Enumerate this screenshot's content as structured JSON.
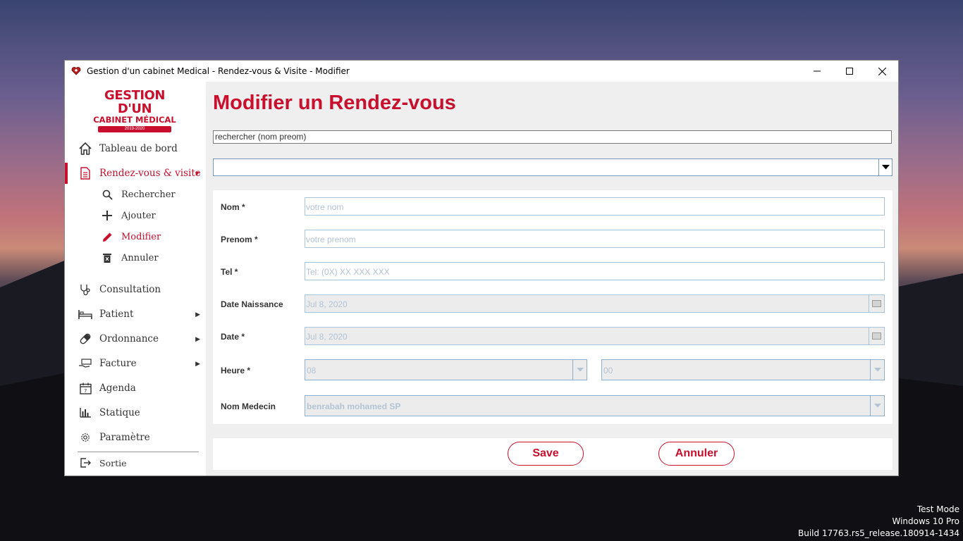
{
  "window": {
    "title": "Gestion d'un cabinet Medical - Rendez-vous & Visite - Modifier"
  },
  "logo": {
    "line1": "GESTION D'UN",
    "line2": "CABINET MÉDICAL",
    "years": "2019-2020"
  },
  "sidebar": {
    "items": [
      {
        "label": "Tableau de bord",
        "icon": "home-icon"
      },
      {
        "label": "Rendez-vous & visite",
        "icon": "document-icon"
      },
      {
        "label": "Consultation",
        "icon": "stethoscope-icon"
      },
      {
        "label": "Patient",
        "icon": "bed-icon"
      },
      {
        "label": "Ordonnance",
        "icon": "pill-icon"
      },
      {
        "label": "Facture",
        "icon": "money-hand-icon"
      },
      {
        "label": "Agenda",
        "icon": "calendar-icon"
      },
      {
        "label": "Statique",
        "icon": "bar-chart-icon"
      },
      {
        "label": "Paramètre",
        "icon": "gear-icon"
      },
      {
        "label": "Sortie",
        "icon": "exit-icon"
      }
    ],
    "subitems": [
      {
        "label": "Rechercher",
        "icon": "search-icon"
      },
      {
        "label": "Ajouter",
        "icon": "plus-icon"
      },
      {
        "label": "Modifier",
        "icon": "pencil-icon"
      },
      {
        "label": "Annuler",
        "icon": "trash-icon"
      }
    ]
  },
  "main": {
    "title": "Modifier un Rendez-vous",
    "search_value": "rechercher (nom preom)",
    "combo_value": ""
  },
  "form": {
    "nom": {
      "label": "Nom *",
      "placeholder": "votre nom"
    },
    "prenom": {
      "label": "Prenom *",
      "placeholder": "votre prenom"
    },
    "tel": {
      "label": "Tel *",
      "placeholder": "Tel: (0X) XX XXX XXX"
    },
    "date_naissance": {
      "label": "Date Naissance",
      "value": "Jul 8, 2020"
    },
    "date": {
      "label": "Date *",
      "value": "Jul 8, 2020"
    },
    "heure": {
      "label": "Heure *",
      "hour": "08",
      "minute": "00"
    },
    "medecin": {
      "label": "Nom Medecin",
      "value": "benrabah mohamed SP"
    }
  },
  "buttons": {
    "save": "Save",
    "annuler": "Annuler"
  },
  "watermark": {
    "line1": "Test Mode",
    "line2": "Windows 10 Pro",
    "line3": "Build 17763.rs5_release.180914-1434"
  },
  "colors": {
    "accent": "#c8102e",
    "background": "#efefef"
  }
}
